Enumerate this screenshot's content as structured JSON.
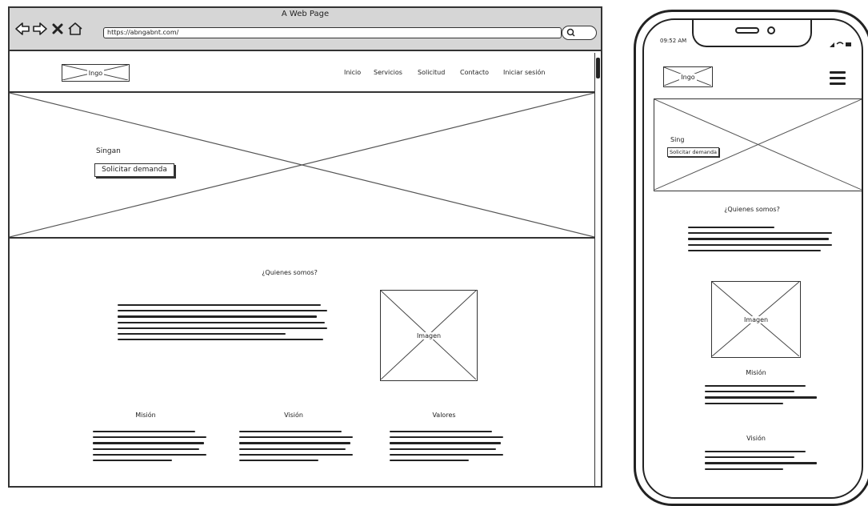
{
  "browser": {
    "title": "A Web Page",
    "url": "https://abngabnt.com/"
  },
  "site": {
    "logo": "Ingo",
    "nav": [
      "Inicio",
      "Servicios",
      "Solicitud",
      "Contacto",
      "Iniciar sesión"
    ],
    "hero": {
      "title": "Singan",
      "cta": "Solicitar demanda"
    },
    "about": {
      "heading": "¿Quienes somos?",
      "image_label": "Imagen"
    },
    "columns": [
      "Misión",
      "Visión",
      "Valores"
    ]
  },
  "phone": {
    "time": "09:52 AM",
    "logo": "Ingo",
    "hero_title": "Sing",
    "hero_cta": "Solicitar demanda",
    "about_heading": "¿Quienes somos?",
    "image_label": "Imagen",
    "mission": "Misión",
    "vision": "Visión"
  }
}
